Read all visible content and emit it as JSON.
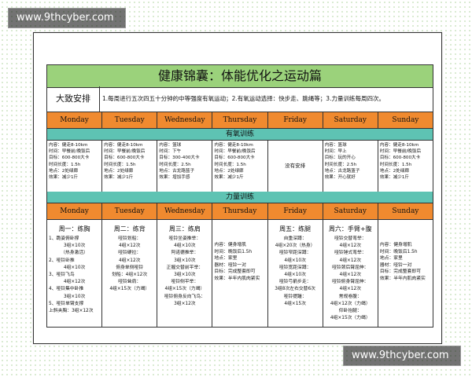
{
  "watermarks": [
    "www.9thcyber.com",
    "www.9thcyber.com"
  ],
  "title": "健康锦囊：体能优化之运动篇",
  "summary": {
    "label": "大致安排",
    "text": "1.每周进行五次四五十分钟的中等强度有氧运动；2.有氧运动选择：快步走、跳绳等；3.力量训练每周四次。"
  },
  "days": [
    "Monday",
    "Tuesday",
    "Wednesday",
    "Thursday",
    "Friday",
    "Saturday",
    "Sunday"
  ],
  "aerobic": {
    "label": "有氧训练",
    "cells": [
      [
        "内容：健走8-10km",
        "时间：早餐前/晚饭后",
        "目标：600-800大卡",
        "时间长度：1.5h",
        "地点：2处绿廊",
        "效果：减少1斤"
      ],
      [
        "内容：健走8-10km",
        "时间：早餐前/晚饭后",
        "目标：600-800大卡",
        "时间长度：1.5h",
        "地点：2处绿廊",
        "效果：减少1斤"
      ],
      [
        "内容：篮球",
        "时间：下午",
        "目标：300-400大卡",
        "时间长度：2.5h",
        "地点：古龙路篮子",
        "效果：增加手感"
      ],
      [
        "内容：健走8-10km",
        "时间：早餐前/晚饭后",
        "目标：600-800大卡",
        "时间长度：1.5h",
        "地点：2处绿廊",
        "效果：减少1斤"
      ],
      [
        "没有安排"
      ],
      [
        "内容：篮球",
        "时间：早上",
        "目标：玩的开心",
        "时间长度：2.5h",
        "地点：古龙路篮子",
        "效果：开心就好"
      ],
      [
        "内容：健走8-10km",
        "时间：早餐前/晚饭后",
        "目标：600-800大卡",
        "时间长度：1.5h",
        "地点：2处绿廊",
        "效果：减少1斤"
      ]
    ]
  },
  "strength": {
    "label": "力量训练",
    "monday": {
      "head": "周一：练胸",
      "lines": [
        "1、跪姿俯卧撑",
        "3组×10次",
        "（热身激活）",
        "2、哑铃卧推",
        "4组×10次",
        "3、哑铃飞鸟",
        "4组×12次",
        "4、哑铃集中卧推",
        "3组×10次",
        "5、哑铃单臂支撑",
        "上斜夹胸：3组×12次"
      ]
    },
    "tuesday": {
      "head": "周二：练背",
      "lines": [
        "哑铃划船：",
        "4组×12次",
        "哑铃硬拉：",
        "4组×12次",
        "俯身单侧哑铃",
        "划船：4组×12次",
        "哑铃耸肩：",
        "4组×15次（力竭）"
      ]
    },
    "wednesday": {
      "head": "周三：练肩",
      "lines": [
        "哑铃坐姿推举：",
        "4组×10次",
        "阿诺德推举：",
        "3组×10次",
        "正握交替前平举：",
        "3组×10次",
        "哑铃侧平举：",
        "4组×15次（力竭）",
        "哑铃俯身反向飞鸟：",
        "3组×12次"
      ]
    },
    "thursday": {
      "lines": [
        "内容：健身增肌",
        "时间：晚饭后1.5h",
        "地点：家里",
        "器材：哑铃一对",
        "目标：完成整套即可",
        "效果：半年内肌肉紧实"
      ]
    },
    "friday": {
      "head": "周五：练腿",
      "lines": [
        "自重深蹲：",
        "4组×20次（热身）",
        "哑铃窄距深蹲：",
        "4组×10次",
        "哑铃宽距深蹲：",
        "4组×10次",
        "哑铃弓箭步走：",
        "3组8次左右交替6次",
        "哑铃提踵：",
        "4组×15次"
      ]
    },
    "saturday": {
      "head": "周六：手臂+腹",
      "lines": [
        "哑铃交替弯举：",
        "4组×12次",
        "哑铃锤式弯举：",
        "4组×12次",
        "哑铃颈后臂屈伸：",
        "4组×12次",
        "哑铃俯身臂屈伸：",
        "4组×12次",
        "常规卷腹：",
        "4组×12次（力竭）",
        "仰卧抬腿：",
        "4组×15次（力竭）"
      ]
    },
    "sunday": {
      "lines": [
        "内容：健身增肌",
        "时间：晚饭后1.5h",
        "地点：家里",
        "器材：哑铃一对",
        "目标：完成整套即可",
        "效果：半年内肌肉紧实"
      ]
    }
  },
  "colors": {
    "title": "#9bd27b",
    "days": "#f08a2f",
    "section": "#5ec3b3"
  }
}
